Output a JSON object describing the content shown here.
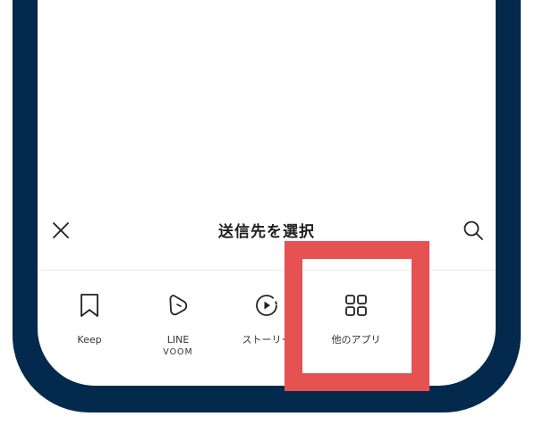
{
  "sheet": {
    "title": "送信先を選択",
    "close_icon": "close-icon",
    "search_icon": "search-icon"
  },
  "share_targets": [
    {
      "label": "Keep",
      "icon": "bookmark-icon"
    },
    {
      "label": "LINE",
      "sublabel": "VOOM",
      "icon": "voom-icon"
    },
    {
      "label": "ストーリー",
      "icon": "play-circle-icon"
    },
    {
      "label": "他のアプリ",
      "icon": "grid-icon"
    }
  ],
  "colors": {
    "frame": "#032a4d",
    "highlight": "#e65152",
    "icon": "#222222"
  }
}
